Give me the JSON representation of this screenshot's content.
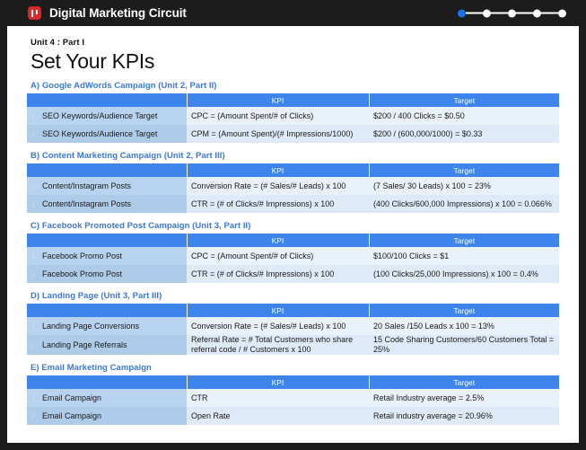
{
  "topbar": {
    "brand_title": "Digital Marketing Circuit",
    "logo_icon": "app-logo-icon",
    "progress": {
      "total": 5,
      "active_index": 0,
      "active_color": "#1a73e8",
      "inactive_color": "#ffffff"
    }
  },
  "page": {
    "unit_label": "Unit 4 : Part I",
    "title": "Set Your KPIs",
    "column_headers": [
      "",
      "KPI",
      "Target"
    ],
    "sections": [
      {
        "heading": "A) Google AdWords Campaign (Unit 2, Part II)",
        "rows": [
          {
            "num": "1.",
            "name": "SEO Keywords/Audience Target",
            "kpi": "CPC = (Amount Spent/# of Clicks)",
            "target": "$200 / 400 Clicks = $0.50"
          },
          {
            "num": "2",
            "name": "SEO Keywords/Audience Target",
            "kpi": "CPM = (Amount Spent)/(# Impressions/1000)",
            "target": "$200 / (600,000/1000) = $0.33"
          }
        ]
      },
      {
        "heading": "B) Content Marketing Campaign (Unit 2, Part III)",
        "rows": [
          {
            "num": "1.",
            "name": "Content/Instagram Posts",
            "kpi": "Conversion Rate = (# Sales/# Leads) x 100",
            "target": "(7 Sales/ 30 Leads) x 100 = 23%"
          },
          {
            "num": "2",
            "name": "Content/Instagram Posts",
            "kpi": "CTR = (# of Clicks/# Impressions) x 100",
            "target": "(400 Clicks/600,000 Impressions) x 100 = 0.066%"
          }
        ]
      },
      {
        "heading": "C) Facebook Promoted Post Campaign (Unit 3, Part II)",
        "rows": [
          {
            "num": "1.",
            "name": "Facebook Promo Post",
            "kpi": "CPC = (Amount Spent/# of Clicks)",
            "target": "$100/100 Clicks = $1"
          },
          {
            "num": "2",
            "name": "Facebook Promo Post",
            "kpi": "CTR = (# of Clicks/# Impressions) x 100",
            "target": "(100 Clicks/25,000 Impressions) x 100 = 0.4%"
          }
        ]
      },
      {
        "heading": "D) Landing Page (Unit 3, Part III)",
        "rows": [
          {
            "num": "1.",
            "name": "Landing Page Conversions",
            "kpi": "Conversion Rate = (# Sales/# Leads) x 100",
            "target": "20 Sales /150 Leads x 100 = 13%"
          },
          {
            "num": "2",
            "name": "Landing Page Referrals",
            "kpi": "Referral Rate = # Total Customers who share referral code / # Customers x 100",
            "target": "15 Code Sharing Customers/60 Customers Total = 25%"
          }
        ]
      },
      {
        "heading": "E) Email Marketing Campaign",
        "rows": [
          {
            "num": "1.",
            "name": "Email Campaign",
            "kpi": "CTR",
            "target": "Retail Industry average = 2.5%"
          },
          {
            "num": "2",
            "name": "Email Campaign",
            "kpi": "Open Rate",
            "target": "Retail industry average = 20.96%"
          }
        ]
      }
    ]
  },
  "colors": {
    "header_blue": "#3d85ec",
    "section_heading_blue": "#3c78d8",
    "first_col_blue": "#b8d3ef",
    "row_light": "#e9f1fb",
    "frame_dark": "#1c1c1c",
    "logo_red": "#d92b2b"
  }
}
